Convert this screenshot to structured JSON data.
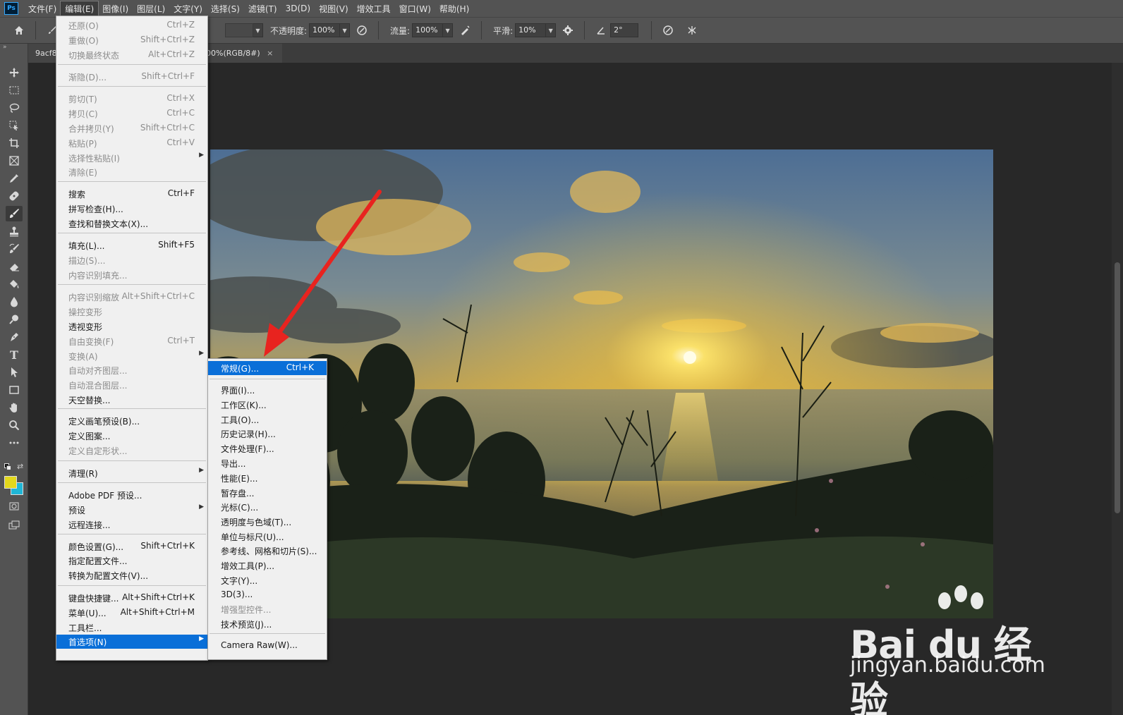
{
  "menubar": {
    "logo": "Ps",
    "items": [
      "文件(F)",
      "编辑(E)",
      "图像(I)",
      "图层(L)",
      "文字(Y)",
      "选择(S)",
      "滤镜(T)",
      "3D(D)",
      "视图(V)",
      "增效工具",
      "窗口(W)",
      "帮助(H)"
    ]
  },
  "options": {
    "opacity_label": "不透明度:",
    "opacity_value": "100%",
    "flow_label": "流量:",
    "flow_value": "100%",
    "smooth_label": "平滑:",
    "smooth_value": "10%",
    "angle_value": "2°"
  },
  "tabs": {
    "doc1": "9acf8",
    "doc2": "00%(RGB/8#)",
    "close": "×"
  },
  "edit_menu": [
    {
      "label": "还原(O)",
      "shortcut": "Ctrl+Z",
      "disabled": true
    },
    {
      "label": "重做(O)",
      "shortcut": "Shift+Ctrl+Z",
      "disabled": true
    },
    {
      "label": "切换最终状态",
      "shortcut": "Alt+Ctrl+Z",
      "disabled": true
    },
    {
      "label": "渐隐(D)...",
      "shortcut": "Shift+Ctrl+F",
      "disabled": true
    },
    {
      "label": "剪切(T)",
      "shortcut": "Ctrl+X",
      "disabled": true
    },
    {
      "label": "拷贝(C)",
      "shortcut": "Ctrl+C",
      "disabled": true
    },
    {
      "label": "合并拷贝(Y)",
      "shortcut": "Shift+Ctrl+C",
      "disabled": true
    },
    {
      "label": "粘贴(P)",
      "shortcut": "Ctrl+V",
      "disabled": true
    },
    {
      "label": "选择性粘贴(I)",
      "shortcut": "",
      "disabled": true,
      "submenu": true
    },
    {
      "label": "清除(E)",
      "shortcut": "",
      "disabled": true
    },
    {
      "label": "搜索",
      "shortcut": "Ctrl+F",
      "disabled": false
    },
    {
      "label": "拼写检查(H)...",
      "shortcut": "",
      "disabled": false
    },
    {
      "label": "查找和替换文本(X)...",
      "shortcut": "",
      "disabled": false
    },
    {
      "label": "填充(L)...",
      "shortcut": "Shift+F5",
      "disabled": false
    },
    {
      "label": "描边(S)...",
      "shortcut": "",
      "disabled": true
    },
    {
      "label": "内容识别填充...",
      "shortcut": "",
      "disabled": true
    },
    {
      "label": "内容识别缩放",
      "shortcut": "Alt+Shift+Ctrl+C",
      "disabled": true
    },
    {
      "label": "操控变形",
      "shortcut": "",
      "disabled": true
    },
    {
      "label": "透视变形",
      "shortcut": "",
      "disabled": false
    },
    {
      "label": "自由变换(F)",
      "shortcut": "Ctrl+T",
      "disabled": true
    },
    {
      "label": "变换(A)",
      "shortcut": "",
      "disabled": true,
      "submenu": true
    },
    {
      "label": "自动对齐图层...",
      "shortcut": "",
      "disabled": true
    },
    {
      "label": "自动混合图层...",
      "shortcut": "",
      "disabled": true
    },
    {
      "label": "天空替换...",
      "shortcut": "",
      "disabled": false
    },
    {
      "label": "定义画笔预设(B)...",
      "shortcut": "",
      "disabled": false
    },
    {
      "label": "定义图案...",
      "shortcut": "",
      "disabled": false
    },
    {
      "label": "定义自定形状...",
      "shortcut": "",
      "disabled": true
    },
    {
      "label": "清理(R)",
      "shortcut": "",
      "disabled": false,
      "submenu": true
    },
    {
      "label": "Adobe PDF 预设...",
      "shortcut": "",
      "disabled": false
    },
    {
      "label": "预设",
      "shortcut": "",
      "disabled": false,
      "submenu": true
    },
    {
      "label": "远程连接...",
      "shortcut": "",
      "disabled": false
    },
    {
      "label": "颜色设置(G)...",
      "shortcut": "Shift+Ctrl+K",
      "disabled": false
    },
    {
      "label": "指定配置文件...",
      "shortcut": "",
      "disabled": false
    },
    {
      "label": "转换为配置文件(V)...",
      "shortcut": "",
      "disabled": false
    },
    {
      "label": "键盘快捷键...",
      "shortcut": "Alt+Shift+Ctrl+K",
      "disabled": false
    },
    {
      "label": "菜单(U)...",
      "shortcut": "Alt+Shift+Ctrl+M",
      "disabled": false
    },
    {
      "label": "工具栏...",
      "shortcut": "",
      "disabled": false
    },
    {
      "label": "首选项(N)",
      "shortcut": "",
      "disabled": false,
      "submenu": true,
      "highlight": true
    }
  ],
  "prefs_menu": [
    {
      "label": "常规(G)...",
      "shortcut": "Ctrl+K",
      "highlight": true
    },
    {
      "label": "界面(I)..."
    },
    {
      "label": "工作区(K)..."
    },
    {
      "label": "工具(O)..."
    },
    {
      "label": "历史记录(H)..."
    },
    {
      "label": "文件处理(F)..."
    },
    {
      "label": "导出..."
    },
    {
      "label": "性能(E)..."
    },
    {
      "label": "暂存盘..."
    },
    {
      "label": "光标(C)..."
    },
    {
      "label": "透明度与色域(T)..."
    },
    {
      "label": "单位与标尺(U)..."
    },
    {
      "label": "参考线、网格和切片(S)..."
    },
    {
      "label": "增效工具(P)..."
    },
    {
      "label": "文字(Y)..."
    },
    {
      "label": "3D(3)..."
    },
    {
      "label": "增强型控件...",
      "disabled": true
    },
    {
      "label": "技术预览(J)..."
    },
    {
      "label": "Camera Raw(W)..."
    }
  ],
  "watermark": {
    "brand": "Bai du 经验",
    "url": "jingyan.baidu.com"
  },
  "colors": {
    "foreground": "#e3d81c",
    "background": "#1fb6d6",
    "highlight": "#0a6fd8",
    "arrow": "#e8231f"
  }
}
